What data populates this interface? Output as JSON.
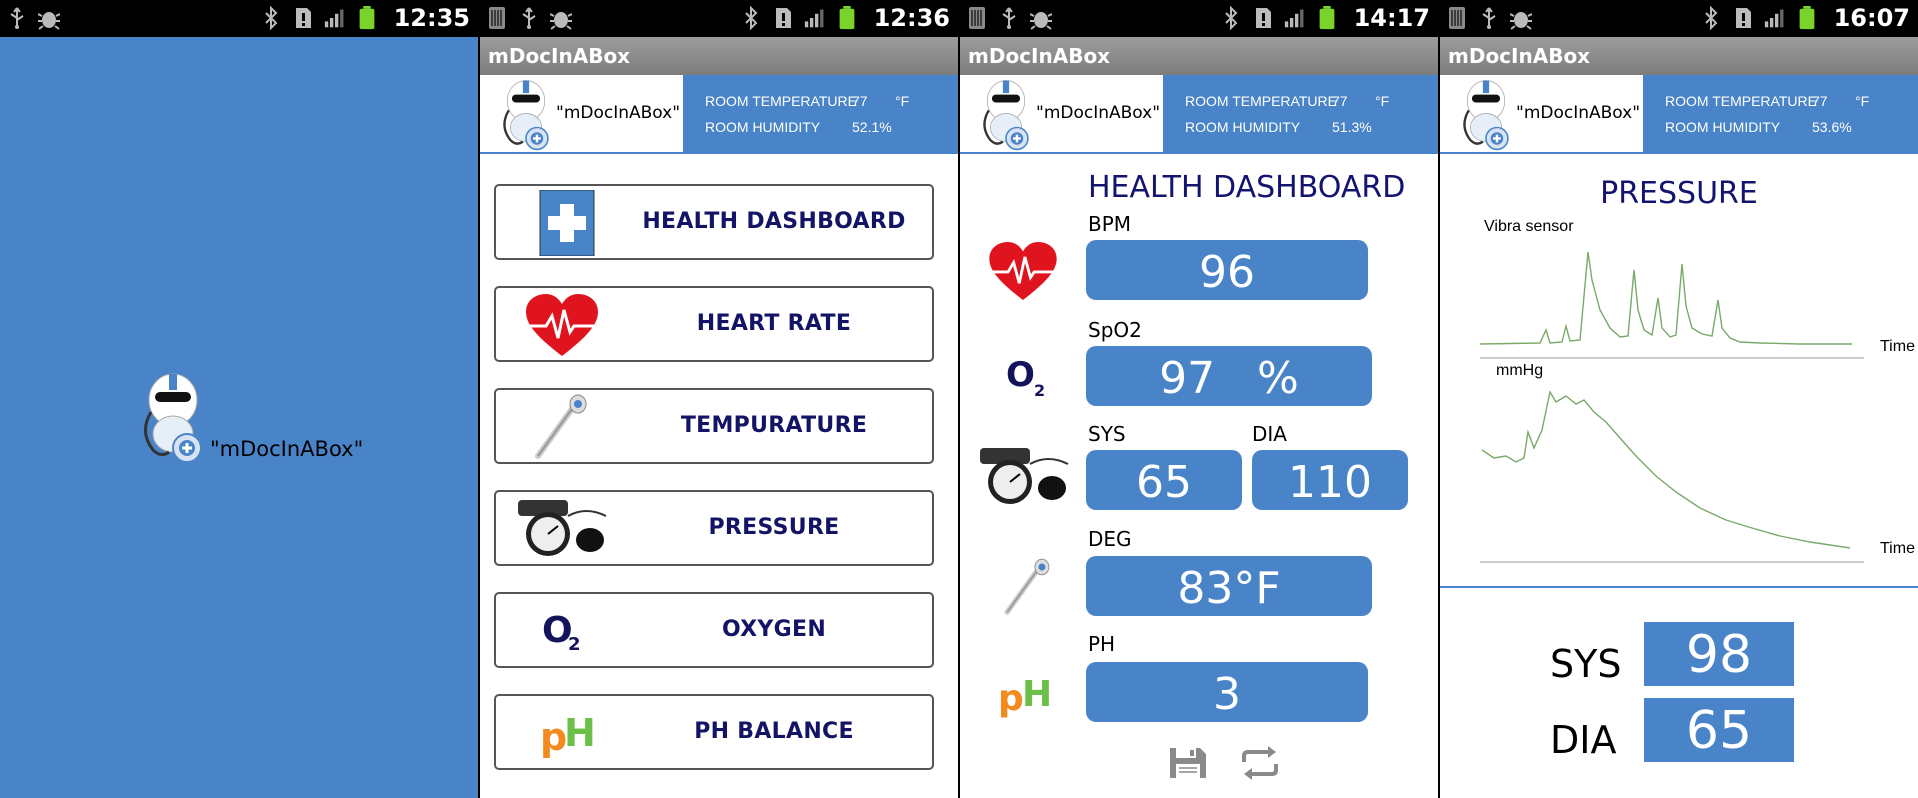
{
  "app": {
    "title": "mDocInABox",
    "brand": "\"mDocInABox\""
  },
  "colors": {
    "accent_blue": "#4a84c8",
    "title_navy": "#131370",
    "titlebar_gray": "#8a8a8a"
  },
  "screens": [
    {
      "clock": "12:35"
    },
    {
      "clock": "12:36"
    },
    {
      "clock": "14:17"
    },
    {
      "clock": "16:07"
    }
  ],
  "environment": [
    {
      "temp_label": "ROOM TEMPERATURE",
      "temp_value": "77",
      "temp_unit": "°F",
      "hum_label": "ROOM HUMIDITY",
      "hum_value": "52.1%"
    },
    {
      "temp_label": "ROOM TEMPERATURE",
      "temp_value": "77",
      "temp_unit": "°F",
      "hum_label": "ROOM HUMIDITY",
      "hum_value": "51.3%"
    },
    {
      "temp_label": "ROOM TEMPERATURE",
      "temp_value": "77",
      "temp_unit": "°F",
      "hum_label": "ROOM HUMIDITY",
      "hum_value": "53.6%"
    }
  ],
  "menu": {
    "items": [
      {
        "label": "HEALTH DASHBOARD",
        "icon": "medical-cross-icon"
      },
      {
        "label": "HEART RATE",
        "icon": "heart-ecg-icon"
      },
      {
        "label": "TEMPURATURE",
        "icon": "thermometer-icon"
      },
      {
        "label": "PRESSURE",
        "icon": "blood-pressure-cuff-icon"
      },
      {
        "label": "OXYGEN",
        "icon": "o2-icon"
      },
      {
        "label": "PH BALANCE",
        "icon": "ph-icon"
      }
    ]
  },
  "dashboard": {
    "title": "HEALTH DASHBOARD",
    "bpm_label": "BPM",
    "bpm_value": "96",
    "spo2_label": "SpO2",
    "spo2_value": "97   %",
    "sys_label": "SYS",
    "sys_value": "65",
    "dia_label": "DIA",
    "dia_value": "110",
    "deg_label": "DEG",
    "deg_value": "83°F",
    "ph_label": "PH",
    "ph_value": "3",
    "icons": [
      "save-icon",
      "repeat-icon"
    ]
  },
  "pressure": {
    "title": "PRESSURE",
    "vibra_label": "Vibra sensor",
    "vibra_x_label": "Time",
    "mmhg_label": "mmHg",
    "mmhg_x_label": "Time",
    "sys_label": "SYS",
    "sys_value": "98",
    "dia_label": "DIA",
    "dia_value": "65"
  },
  "icons_status": [
    "usb-icon",
    "android-debug-icon",
    "bluetooth-icon",
    "alert-icon",
    "signal-icon",
    "battery-icon",
    "sim-icon"
  ]
}
